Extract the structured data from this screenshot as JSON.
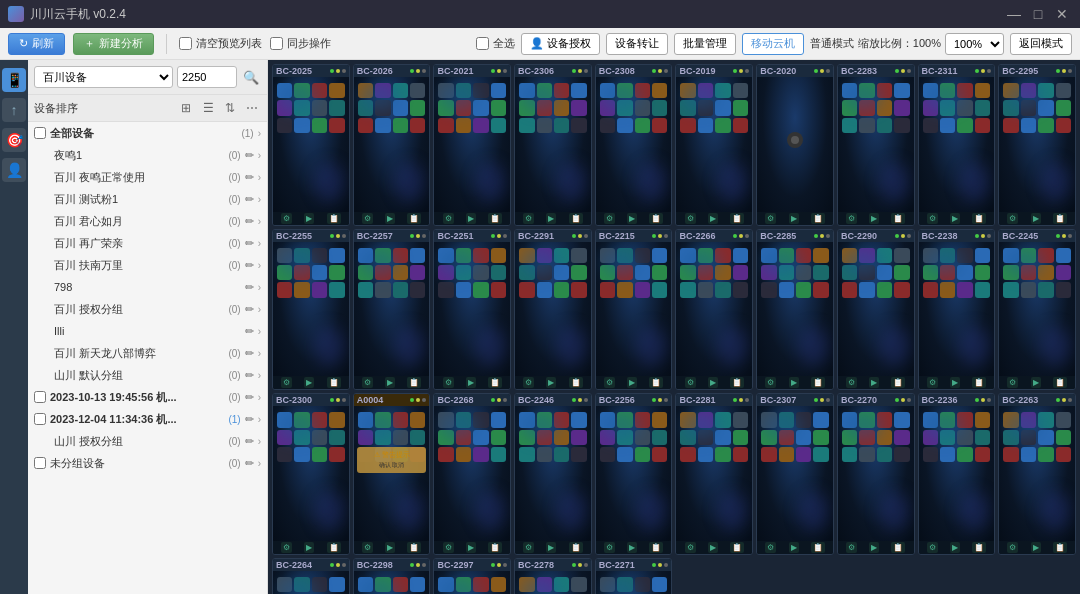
{
  "app": {
    "title": "川川云手机 v0.2.4",
    "icon": "phone-icon"
  },
  "window_controls": {
    "minimize": "—",
    "maximize": "□",
    "close": "✕"
  },
  "toolbar": {
    "refresh_label": "刷新",
    "new_analysis_label": "新建分析",
    "clear_queue_label": "清空预览列表",
    "sync_op_label": "同步操作",
    "select_all_label": "全选",
    "device_control_label": "设备授权",
    "device_transfer_label": "设备转让",
    "quantity_mgmt_label": "批量管理",
    "move_cloud_label": "移动云机",
    "normal_mode_label": "普通模式",
    "zoom_label": "缩放比例：100%",
    "back_mode_label": "返回模式"
  },
  "sidebar": {
    "icons": [
      "📱",
      "↑",
      "🎯",
      "👤"
    ]
  },
  "left_panel": {
    "device_selector": {
      "options": [
        "百川设备"
      ],
      "input_placeholder": "2250",
      "search_placeholder": "搜索"
    },
    "list_label": "设备排序",
    "tree_items": [
      {
        "id": "all",
        "label": "全部设备",
        "count": "(1)",
        "indent": 0,
        "bold": true
      },
      {
        "id": "g1",
        "label": "夜鸣1",
        "count": "(0)",
        "indent": 1
      },
      {
        "id": "g2",
        "label": "百川 夜鸣正常使用",
        "count": "(0)",
        "indent": 1
      },
      {
        "id": "g3",
        "label": "百川 测试粉1",
        "count": "(0)",
        "indent": 1
      },
      {
        "id": "g4",
        "label": "百川 君心如月",
        "count": "(0)",
        "indent": 1
      },
      {
        "id": "g5",
        "label": "百川 再广荣亲",
        "count": "(0)",
        "indent": 1
      },
      {
        "id": "g6",
        "label": "百川 扶南万里",
        "count": "(0)",
        "indent": 1
      },
      {
        "id": "g7",
        "label": "798",
        "count": "",
        "indent": 1
      },
      {
        "id": "g8",
        "label": "百川 授权分组",
        "count": "(0)",
        "indent": 1
      },
      {
        "id": "g9",
        "label": "Illi",
        "count": "",
        "indent": 1
      },
      {
        "id": "g10",
        "label": "百川 新天龙八部博弈",
        "count": "(0)",
        "indent": 1
      },
      {
        "id": "g11",
        "label": "山川 默认分组",
        "count": "(0)",
        "indent": 1
      },
      {
        "id": "g12",
        "label": "2023-10-13 19:45:56 机...",
        "count": "(0)",
        "indent": 0,
        "bold": true
      },
      {
        "id": "g13",
        "label": "2023-12-04 11:34:36 机...",
        "count": "(1)",
        "indent": 0,
        "bold": true,
        "count_blue": true
      },
      {
        "id": "g14",
        "label": "山川 授权分组",
        "count": "(0)",
        "indent": 1
      },
      {
        "id": "g15",
        "label": "未分组设备",
        "count": "(0)",
        "indent": 0
      }
    ]
  },
  "devices": [
    {
      "id": "BC-2025",
      "row": 0
    },
    {
      "id": "BC-2026",
      "row": 0
    },
    {
      "id": "BC-2021",
      "row": 0
    },
    {
      "id": "BC-2306",
      "row": 0
    },
    {
      "id": "BC-2308",
      "row": 0
    },
    {
      "id": "BC-2019",
      "row": 0
    },
    {
      "id": "BC-2020",
      "row": 0,
      "dark": true
    },
    {
      "id": "BC-2283",
      "row": 0
    },
    {
      "id": "BC-2311",
      "row": 1
    },
    {
      "id": "BC-2295",
      "row": 1
    },
    {
      "id": "BC-2255",
      "row": 1
    },
    {
      "id": "BC-2257",
      "row": 1
    },
    {
      "id": "BC-2251",
      "row": 1
    },
    {
      "id": "BC-2291",
      "row": 1
    },
    {
      "id": "BC-2215",
      "row": 1
    },
    {
      "id": "BC-2266",
      "row": 1
    },
    {
      "id": "BC-2285",
      "row": 1
    },
    {
      "id": "BC-2290",
      "row": 2
    },
    {
      "id": "BC-2238",
      "row": 2
    },
    {
      "id": "BC-2245",
      "row": 2
    },
    {
      "id": "BC-2300",
      "row": 2
    },
    {
      "id": "A0004",
      "row": 2,
      "alert": true
    },
    {
      "id": "BC-2268",
      "row": 2
    },
    {
      "id": "BC-2246",
      "row": 2
    },
    {
      "id": "BC-2256",
      "row": 2
    },
    {
      "id": "BC-2281",
      "row": 2
    },
    {
      "id": "BC-2307",
      "row": 3
    },
    {
      "id": "BC-2270",
      "row": 3
    },
    {
      "id": "BC-2236",
      "row": 3
    },
    {
      "id": "BC-2263",
      "row": 3
    },
    {
      "id": "BC-2264",
      "row": 3
    },
    {
      "id": "BC-2298",
      "row": 3
    },
    {
      "id": "BC-2297",
      "row": 3
    },
    {
      "id": "BC-2278",
      "row": 3
    },
    {
      "id": "BC-2271",
      "row": 3
    }
  ],
  "colors": {
    "accent": "#4a90d9",
    "bg_dark": "#1a2535",
    "bg_panel": "#f5f5f5",
    "sidebar_bg": "#2b3a4a"
  }
}
